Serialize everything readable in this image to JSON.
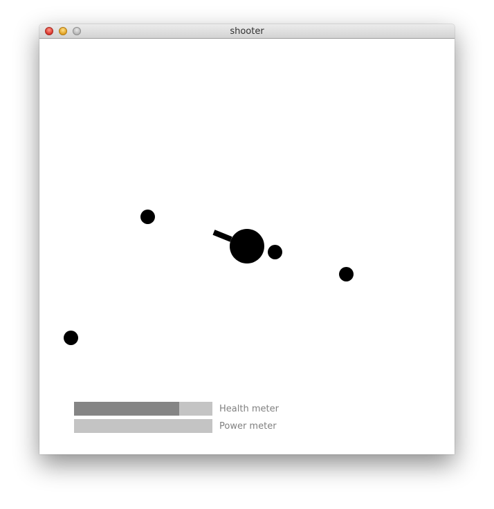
{
  "window": {
    "title": "shooter",
    "controls": [
      "close-icon",
      "minimize-icon",
      "zoom-icon"
    ]
  },
  "game": {
    "player": {
      "barrel_direction": "up-left"
    },
    "enemy_count": 4,
    "projectile_count": 1
  },
  "hud": {
    "health": {
      "label": "Health meter",
      "level_fraction": 0.76
    },
    "power": {
      "label": "Power meter",
      "level_fraction": 0.0
    }
  },
  "colors": {
    "canvas_background": "#ffffff",
    "sprites": "#000000",
    "meter_track": "#c4c4c4",
    "meter_fill": "#858585",
    "meter_label": "#808080"
  }
}
